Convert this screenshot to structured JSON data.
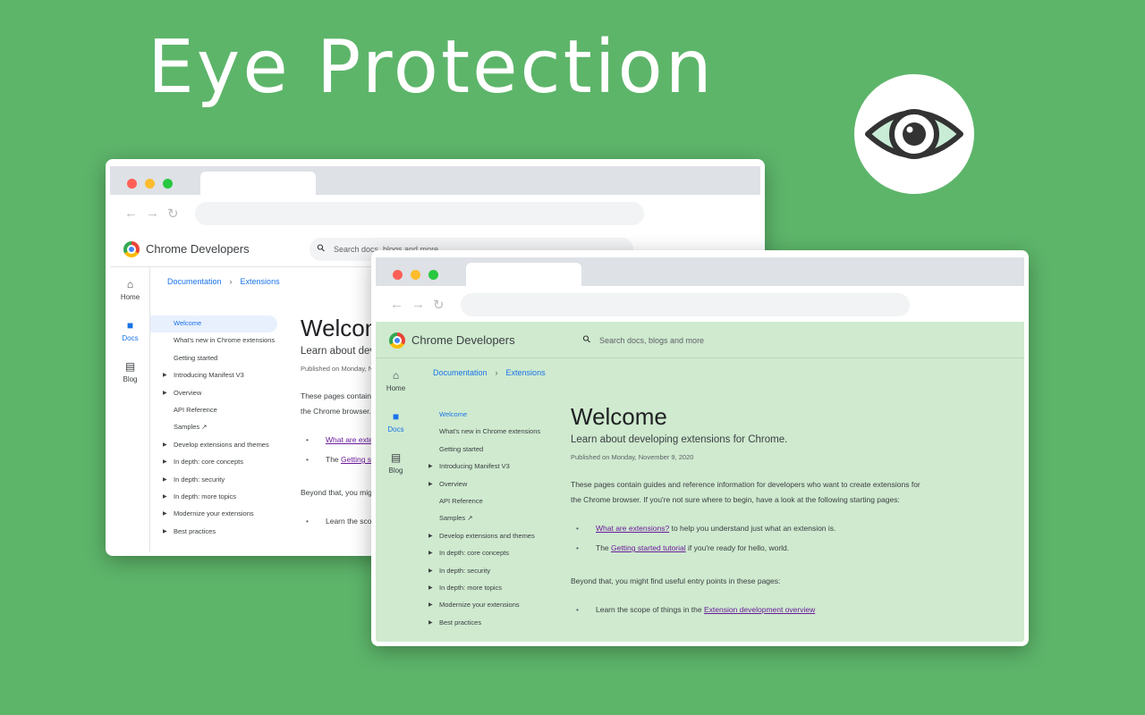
{
  "hero": {
    "title": "Eye Protection",
    "badge_icon": "eye-icon"
  },
  "colors": {
    "background": "#5db56a",
    "protected_page": "#cfeacf",
    "link": "#6a1b9a",
    "accent": "#1a73e8"
  },
  "browser": {
    "dots": [
      "#ff5f57",
      "#febc2e",
      "#28c840"
    ],
    "site_name": "Chrome Developers",
    "search_placeholder": "Search docs, blogs and more",
    "rail": [
      {
        "label": "Home",
        "icon": "home-icon"
      },
      {
        "label": "Docs",
        "icon": "docs-icon",
        "active": true
      },
      {
        "label": "Blog",
        "icon": "blog-icon"
      }
    ],
    "breadcrumb": [
      "Documentation",
      "Extensions"
    ],
    "nav": [
      {
        "label": "Welcome",
        "active": true
      },
      {
        "label": "What's new in Chrome extensions"
      },
      {
        "label": "Getting started"
      },
      {
        "label": "Introducing Manifest V3",
        "expandable": true
      },
      {
        "label": "Overview",
        "expandable": true
      },
      {
        "label": "API Reference"
      },
      {
        "label": "Samples ↗"
      },
      {
        "label": "Develop extensions and themes",
        "expandable": true
      },
      {
        "label": "In depth: core concepts",
        "expandable": true
      },
      {
        "label": "In depth: security",
        "expandable": true
      },
      {
        "label": "In depth: more topics",
        "expandable": true
      },
      {
        "label": "Modernize your extensions",
        "expandable": true
      },
      {
        "label": "Best practices",
        "expandable": true
      }
    ],
    "article": {
      "title": "Welcome",
      "subtitle": "Learn about developing extensions for Chrome.",
      "published": "Published on Monday, November 9, 2020",
      "intro": "These pages contain guides and reference information for developers who want to create extensions for the Chrome browser. If you're not sure where to begin, have a look at the following starting pages:",
      "bullets1": [
        {
          "link": "What are extensions?",
          "rest": " to help you understand just what an extension is."
        },
        {
          "pre": "The ",
          "link": "Getting started tutorial",
          "rest": " if you're ready for hello, world."
        }
      ],
      "beyond": "Beyond that, you might find useful entry points in these pages:",
      "bullets2": [
        {
          "pre": "Learn the scope of things in the ",
          "link": "Extension development overview",
          "rest": ""
        }
      ]
    }
  }
}
